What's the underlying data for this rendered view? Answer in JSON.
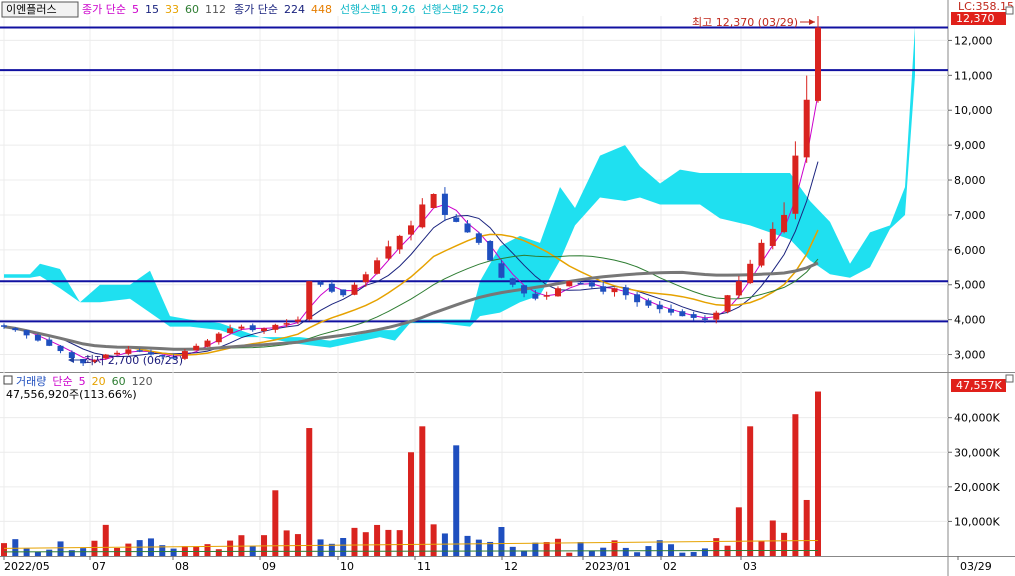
{
  "window": {
    "title_button": "이엔플러스"
  },
  "legend_price": {
    "ma_label": "종가 단순",
    "ma_periods": [
      {
        "text": "5",
        "color": "#cc00cc"
      },
      {
        "text": "15",
        "color": "#1a237e"
      },
      {
        "text": "33",
        "color": "#e6a200"
      },
      {
        "text": "60",
        "color": "#2e7d32"
      },
      {
        "text": "112",
        "color": "#555555"
      }
    ],
    "ma2_label": "종가 단순",
    "ma2_periods": [
      {
        "text": "224",
        "color": "#1a237e"
      },
      {
        "text": "448",
        "color": "#e67e00"
      }
    ],
    "span1": "선행스팬1 9,26",
    "span2": "선행스팬2 52,26"
  },
  "legend_volume": {
    "title": "거래량",
    "ma_label": "단순",
    "ma_periods": [
      {
        "text": "5",
        "color": "#cc00cc"
      },
      {
        "text": "20",
        "color": "#e6a200"
      },
      {
        "text": "60",
        "color": "#2e7d32"
      },
      {
        "text": "120",
        "color": "#555555"
      }
    ],
    "current_volume": "47,556,920주(113.66%)"
  },
  "annotations": {
    "high": "최고 12,370 (03/29)",
    "low": "최저 2,700 (06/23)",
    "corner": "LC:358.15",
    "price_badge": "12,370",
    "volume_badge": "47,557K"
  },
  "colors": {
    "up": "#d9231f",
    "down": "#1f4fbf",
    "hline": "#1010a0",
    "cloud": "#1fe0f0",
    "badge": "#e0201a"
  },
  "chart_data": [
    {
      "type": "candlestick",
      "title": "",
      "ylim": [
        2500,
        12700
      ],
      "y_ticks": [
        3000,
        4000,
        5000,
        6000,
        7000,
        8000,
        9000,
        10000,
        11000,
        12000
      ],
      "y_tick_labels": [
        "3,000",
        "4,000",
        "5,000",
        "6,000",
        "7,000",
        "8,000",
        "9,000",
        "10,000",
        "11,000",
        "12,000"
      ],
      "x_tick_labels": [
        "2022/05",
        "07",
        "08",
        "09",
        "10",
        "11",
        "12",
        "2023/01",
        "02",
        "03",
        "03/29"
      ],
      "horizontal_lines": [
        12370,
        11150,
        5100,
        3950
      ],
      "high": 12370,
      "low": 2700,
      "approx_close_series": [
        3800,
        3700,
        3550,
        3400,
        3250,
        3100,
        2900,
        2750,
        2850,
        3000,
        3050,
        3150,
        3100,
        3000,
        2950,
        2900,
        3100,
        3250,
        3400,
        3600,
        3750,
        3800,
        3700,
        3750,
        3850,
        3900,
        4000,
        5100,
        5000,
        4800,
        4700,
        5000,
        5300,
        5700,
        6100,
        6400,
        6700,
        7300,
        7600,
        7000,
        6800,
        6500,
        6200,
        5700,
        5200,
        5000,
        4750,
        4600,
        4700,
        4900,
        5100,
        5050,
        4950,
        4800,
        4900,
        4700,
        4500,
        4400,
        4300,
        4200,
        4100,
        4050,
        4000,
        4200,
        4700,
        5100,
        5600,
        6200,
        6600,
        7000,
        8700,
        10300,
        12370
      ]
    },
    {
      "type": "bar",
      "title": "거래량",
      "unit": "K",
      "ylim": [
        0,
        48000
      ],
      "y_ticks": [
        10000,
        20000,
        30000,
        40000
      ],
      "y_tick_labels": [
        "10,000K",
        "20,000K",
        "30,000K",
        "40,000K"
      ],
      "last_value": 47557,
      "notable_spikes": [
        {
          "label": "09",
          "value": 9000
        },
        {
          "label": "09",
          "value": 19000
        },
        {
          "label": "10",
          "value": 37000
        },
        {
          "label": "11",
          "value": 30000
        },
        {
          "label": "11",
          "value": 37500
        },
        {
          "label": "12",
          "value": 32000
        },
        {
          "label": "03",
          "value": 37500
        },
        {
          "label": "03",
          "value": 41000
        },
        {
          "label": "03",
          "value": 47557
        }
      ]
    }
  ]
}
